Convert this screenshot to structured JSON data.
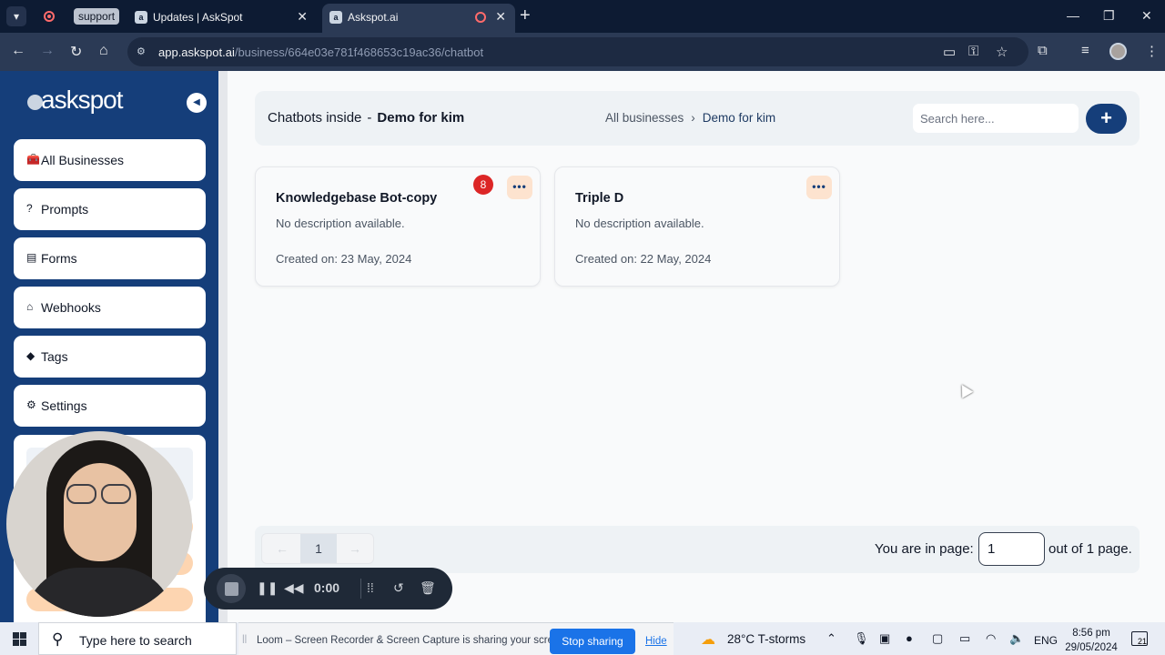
{
  "browser": {
    "group_chip": "support",
    "tabs": [
      {
        "title": "Updates | AskSpot"
      },
      {
        "title": "Askspot.ai"
      }
    ],
    "url_host": "app.askspot.ai",
    "url_path": "/business/664e03e781f468653c19ac36/chatbot"
  },
  "sidebar": {
    "logo": "askspot",
    "items": [
      {
        "label": "All Businesses",
        "icon": "briefcase-icon"
      },
      {
        "label": "Prompts",
        "icon": "question-icon"
      },
      {
        "label": "Forms",
        "icon": "form-icon"
      },
      {
        "label": "Webhooks",
        "icon": "inbox-icon"
      },
      {
        "label": "Tags",
        "icon": "tags-icon"
      },
      {
        "label": "Settings",
        "icon": "gear-icon"
      }
    ]
  },
  "header": {
    "title_prefix": "Chatbots inside",
    "title_separator": "-",
    "business_name": "Demo for kim",
    "breadcrumb_root": "All businesses",
    "breadcrumb_current": "Demo for kim",
    "search_placeholder": "Search here..."
  },
  "cards": [
    {
      "name": "Knowledgebase Bot-copy",
      "description": "No description available.",
      "created": "Created on: 23 May, 2024",
      "badge": "8"
    },
    {
      "name": "Triple D",
      "description": "No description available.",
      "created": "Created on: 22 May, 2024"
    }
  ],
  "pagination": {
    "current_page": "1",
    "label_before": "You are in page:",
    "page_input_value": "1",
    "label_after": "out of 1 page."
  },
  "recorder": {
    "time": "0:00"
  },
  "taskbar": {
    "search_placeholder": "Type here to search",
    "loom_message": "Loom – Screen Recorder & Screen Capture is sharing your screen.",
    "stop_sharing": "Stop sharing",
    "hide": "Hide",
    "weather": "28°C  T-storms",
    "language": "ENG",
    "time": "8:56 pm",
    "date": "29/05/2024",
    "notification_count": "21"
  },
  "colors": {
    "sidebar": "#153e7a",
    "accent": "#153e7a",
    "badge": "#dc2626",
    "menu_button": "#fde3cf"
  }
}
